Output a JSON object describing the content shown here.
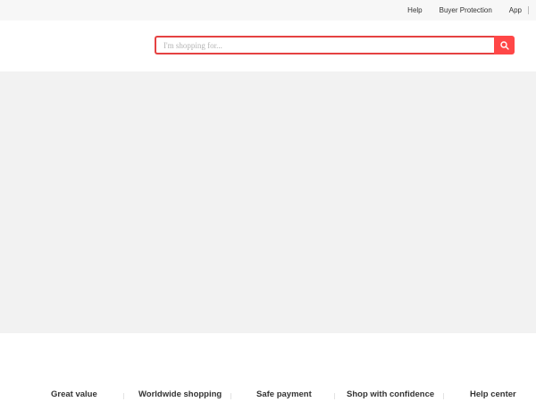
{
  "topbar": {
    "links": [
      {
        "label": "Help"
      },
      {
        "label": "Buyer Protection"
      },
      {
        "label": "App"
      }
    ]
  },
  "search": {
    "placeholder": "I'm shopping for...",
    "value": "",
    "button_icon": "search-icon",
    "accent_color": "#ff4747"
  },
  "features": [
    {
      "label": "Great value"
    },
    {
      "label": "Worldwide shopping"
    },
    {
      "label": "Safe payment"
    },
    {
      "label": "Shop with confidence"
    },
    {
      "label": "Help center"
    }
  ]
}
